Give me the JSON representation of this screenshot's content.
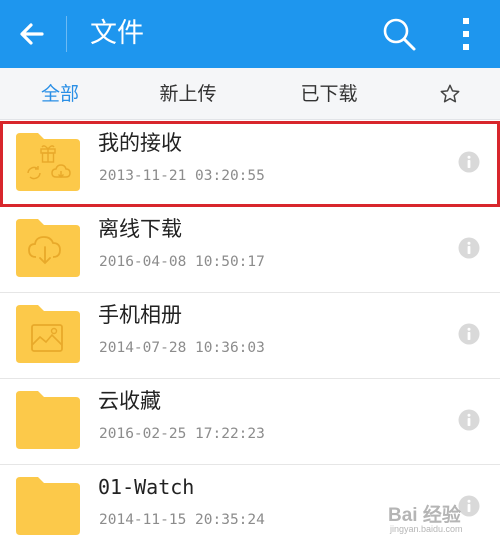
{
  "appbar": {
    "title": "文件",
    "back_icon": "arrow-left-icon",
    "search_icon": "search-icon",
    "more_icon": "more-vertical-icon",
    "color": "#1e96ee"
  },
  "tabs": [
    {
      "label": "全部",
      "active": true
    },
    {
      "label": "新上传",
      "active": false
    },
    {
      "label": "已下载",
      "active": false
    },
    {
      "label": "",
      "icon": "star-outline-icon",
      "active": false
    }
  ],
  "files": [
    {
      "name": "我的接收",
      "date": "2013-11-21 03:20:55",
      "icon": "folder-gift-sync-icon",
      "highlighted": true
    },
    {
      "name": "离线下载",
      "date": "2016-04-08 10:50:17",
      "icon": "folder-cloud-download-icon"
    },
    {
      "name": "手机相册",
      "date": "2014-07-28 10:36:03",
      "icon": "folder-photo-icon"
    },
    {
      "name": "云收藏",
      "date": "2016-02-25 17:22:23",
      "icon": "folder-icon"
    },
    {
      "name": "01-Watch",
      "date": "2014-11-15 20:35:24",
      "icon": "folder-icon"
    }
  ],
  "colors": {
    "accent": "#2a8fe6",
    "folder": "#fcc94a",
    "highlight_border": "#d8262c"
  },
  "watermark": {
    "text": "Bai 经验",
    "sub": "jingyan.baidu.com"
  }
}
